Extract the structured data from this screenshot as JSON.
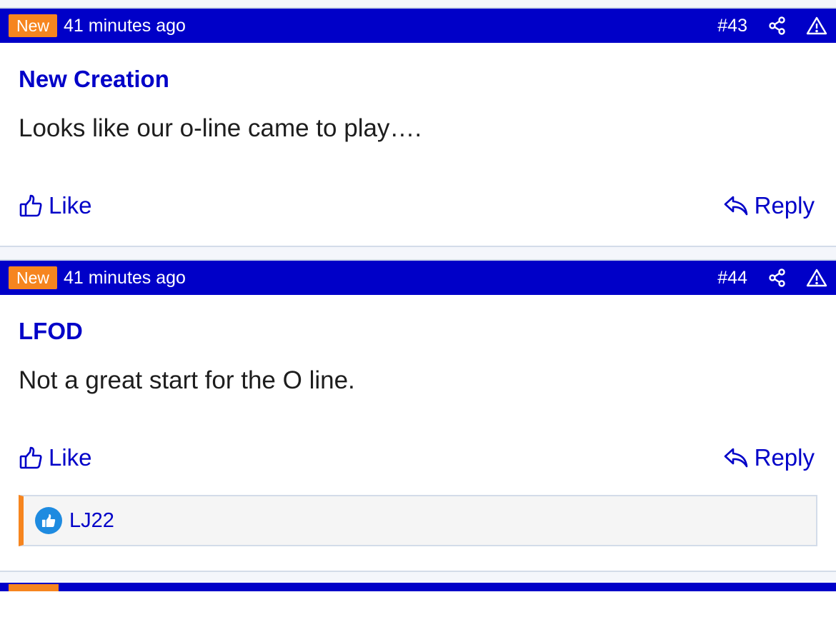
{
  "posts": [
    {
      "badge": "New",
      "time": "41 minutes ago",
      "number": "#43",
      "author": "New Creation",
      "message": "Looks like our o-line came to play….",
      "like_label": "Like",
      "reply_label": "Reply",
      "reactions": []
    },
    {
      "badge": "New",
      "time": "41 minutes ago",
      "number": "#44",
      "author": "LFOD",
      "message": "Not a great start for the O line.",
      "like_label": "Like",
      "reply_label": "Reply",
      "reactions": [
        "LJ22"
      ]
    }
  ],
  "colors": {
    "header_bg": "#0000c8",
    "badge_bg": "#f6851f",
    "link": "#0000c8"
  },
  "icons": [
    "share-icon",
    "warning-icon",
    "thumbs-up-icon",
    "reply-icon",
    "like-badge-icon"
  ]
}
